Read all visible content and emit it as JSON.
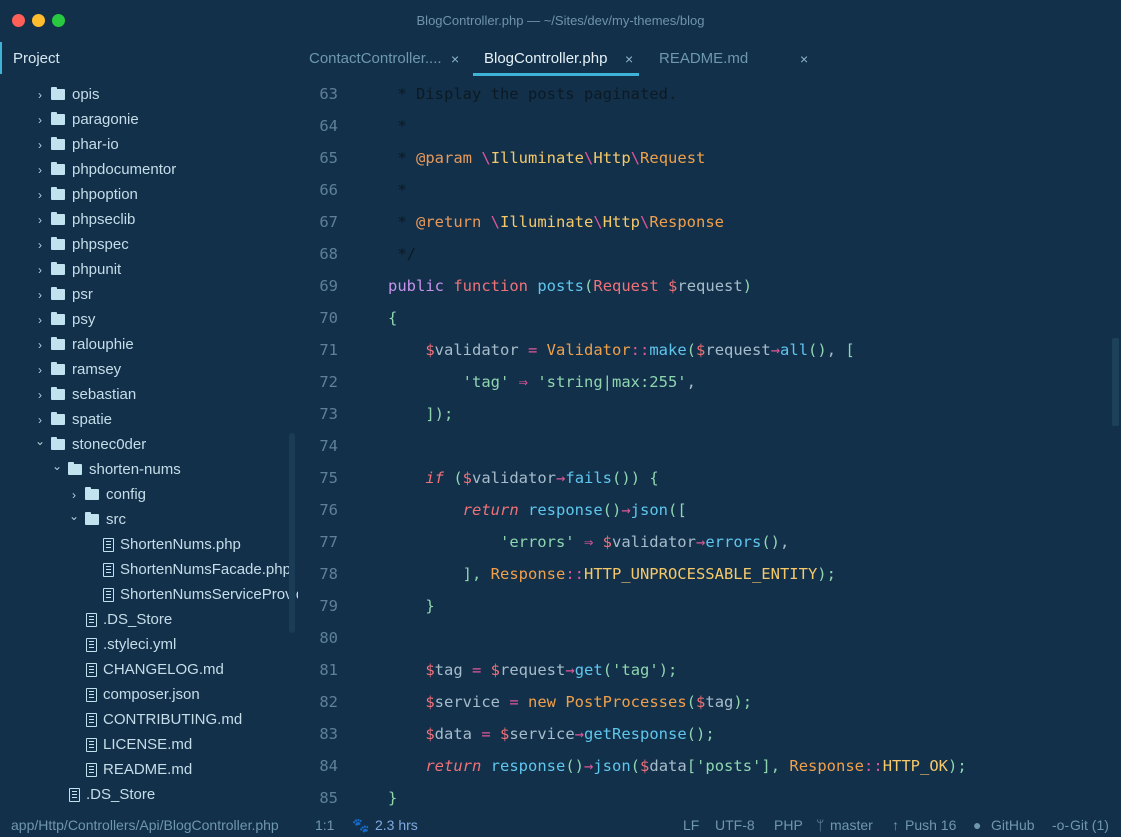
{
  "window": {
    "title": "BlogController.php — ~/Sites/dev/my-themes/blog",
    "traffic": [
      "#fe5f57",
      "#febc2e",
      "#28c840"
    ]
  },
  "sidebar": {
    "title": "Project",
    "items": [
      {
        "label": "opis",
        "type": "folder",
        "level": 1,
        "open": false
      },
      {
        "label": "paragonie",
        "type": "folder",
        "level": 1,
        "open": false
      },
      {
        "label": "phar-io",
        "type": "folder",
        "level": 1,
        "open": false
      },
      {
        "label": "phpdocumentor",
        "type": "folder",
        "level": 1,
        "open": false
      },
      {
        "label": "phpoption",
        "type": "folder",
        "level": 1,
        "open": false
      },
      {
        "label": "phpseclib",
        "type": "folder",
        "level": 1,
        "open": false
      },
      {
        "label": "phpspec",
        "type": "folder",
        "level": 1,
        "open": false
      },
      {
        "label": "phpunit",
        "type": "folder",
        "level": 1,
        "open": false
      },
      {
        "label": "psr",
        "type": "folder",
        "level": 1,
        "open": false
      },
      {
        "label": "psy",
        "type": "folder",
        "level": 1,
        "open": false
      },
      {
        "label": "ralouphie",
        "type": "folder",
        "level": 1,
        "open": false
      },
      {
        "label": "ramsey",
        "type": "folder",
        "level": 1,
        "open": false
      },
      {
        "label": "sebastian",
        "type": "folder",
        "level": 1,
        "open": false
      },
      {
        "label": "spatie",
        "type": "folder",
        "level": 1,
        "open": false
      },
      {
        "label": "stonec0der",
        "type": "folder",
        "level": 1,
        "open": true
      },
      {
        "label": "shorten-nums",
        "type": "folder",
        "level": 2,
        "open": true
      },
      {
        "label": "config",
        "type": "folder",
        "level": 3,
        "open": false
      },
      {
        "label": "src",
        "type": "folder",
        "level": 3,
        "open": true
      },
      {
        "label": "ShortenNums.php",
        "type": "file",
        "level": 4
      },
      {
        "label": "ShortenNumsFacade.php",
        "type": "file",
        "level": 4
      },
      {
        "label": "ShortenNumsServiceProvider.php",
        "type": "file",
        "level": 4
      },
      {
        "label": ".DS_Store",
        "type": "file",
        "level": 3
      },
      {
        "label": ".styleci.yml",
        "type": "file",
        "level": 3
      },
      {
        "label": "CHANGELOG.md",
        "type": "file",
        "level": 3
      },
      {
        "label": "composer.json",
        "type": "file",
        "level": 3
      },
      {
        "label": "CONTRIBUTING.md",
        "type": "file",
        "level": 3
      },
      {
        "label": "LICENSE.md",
        "type": "file",
        "level": 3
      },
      {
        "label": "README.md",
        "type": "file",
        "level": 3
      },
      {
        "label": ".DS_Store",
        "type": "file",
        "level": 2
      }
    ]
  },
  "tabs": [
    {
      "label": "ContactController....",
      "active": false
    },
    {
      "label": "BlogController.php",
      "active": true
    },
    {
      "label": "README.md",
      "active": false
    }
  ],
  "tab_close": "×",
  "code": [
    {
      "n": "63",
      "t": [
        [
          "    * Display the posts paginated.",
          "comment"
        ]
      ]
    },
    {
      "n": "64",
      "t": [
        [
          "    *",
          "comment"
        ]
      ]
    },
    {
      "n": "65",
      "t": [
        [
          "    * ",
          "comment"
        ],
        [
          "@param",
          "doctag"
        ],
        [
          " ",
          "plain"
        ],
        [
          "\\",
          "nssep"
        ],
        [
          "Illuminate",
          "ns"
        ],
        [
          "\\",
          "nssep"
        ],
        [
          "Http",
          "ns"
        ],
        [
          "\\",
          "nssep"
        ],
        [
          "Request",
          "class"
        ]
      ]
    },
    {
      "n": "66",
      "t": [
        [
          "    *",
          "comment"
        ]
      ]
    },
    {
      "n": "67",
      "t": [
        [
          "    * ",
          "comment"
        ],
        [
          "@return",
          "doctag"
        ],
        [
          " ",
          "plain"
        ],
        [
          "\\",
          "nssep"
        ],
        [
          "Illuminate",
          "ns"
        ],
        [
          "\\",
          "nssep"
        ],
        [
          "Http",
          "ns"
        ],
        [
          "\\",
          "nssep"
        ],
        [
          "Response",
          "class"
        ]
      ]
    },
    {
      "n": "68",
      "t": [
        [
          "    */",
          "comment"
        ]
      ]
    },
    {
      "n": "69",
      "t": [
        [
          "   public",
          "kw"
        ],
        [
          " ",
          "plain"
        ],
        [
          "function",
          "fn"
        ],
        [
          " ",
          "plain"
        ],
        [
          "posts",
          "name"
        ],
        [
          "(",
          "punc"
        ],
        [
          "Request",
          "fn"
        ],
        [
          " ",
          "plain"
        ],
        [
          "$",
          "dollar"
        ],
        [
          "request",
          "var"
        ],
        [
          ")",
          "punc"
        ]
      ]
    },
    {
      "n": "70",
      "t": [
        [
          "   {",
          "punc"
        ]
      ]
    },
    {
      "n": "71",
      "t": [
        [
          "       ",
          "plain"
        ],
        [
          "$",
          "dollar"
        ],
        [
          "validator",
          "var"
        ],
        [
          " = ",
          "op"
        ],
        [
          "Validator",
          "class"
        ],
        [
          "::",
          "op"
        ],
        [
          "make",
          "name"
        ],
        [
          "(",
          "punc"
        ],
        [
          "$",
          "dollar"
        ],
        [
          "request",
          "var"
        ],
        [
          "→",
          "op"
        ],
        [
          "all",
          "name"
        ],
        [
          "()",
          "punc"
        ],
        [
          ", ",
          "plain"
        ],
        [
          "[",
          "punc"
        ]
      ]
    },
    {
      "n": "72",
      "t": [
        [
          "           ",
          "plain"
        ],
        [
          "'tag'",
          "str"
        ],
        [
          " ⇒ ",
          "op"
        ],
        [
          "'string|max:255'",
          "str"
        ],
        [
          ",",
          "plain"
        ]
      ]
    },
    {
      "n": "73",
      "t": [
        [
          "       ",
          "plain"
        ],
        [
          "]);",
          "punc"
        ]
      ]
    },
    {
      "n": "74",
      "t": []
    },
    {
      "n": "75",
      "t": [
        [
          "       ",
          "plain"
        ],
        [
          "if",
          "kwi"
        ],
        [
          " (",
          "punc"
        ],
        [
          "$",
          "dollar"
        ],
        [
          "validator",
          "var"
        ],
        [
          "→",
          "op"
        ],
        [
          "fails",
          "name"
        ],
        [
          "()) {",
          "punc"
        ]
      ]
    },
    {
      "n": "76",
      "t": [
        [
          "           ",
          "plain"
        ],
        [
          "return",
          "kwi"
        ],
        [
          " ",
          "plain"
        ],
        [
          "response",
          "name"
        ],
        [
          "()",
          "punc"
        ],
        [
          "→",
          "op"
        ],
        [
          "json",
          "name"
        ],
        [
          "([",
          "punc"
        ]
      ]
    },
    {
      "n": "77",
      "t": [
        [
          "               ",
          "plain"
        ],
        [
          "'errors'",
          "str"
        ],
        [
          " ⇒ ",
          "op"
        ],
        [
          "$",
          "dollar"
        ],
        [
          "validator",
          "var"
        ],
        [
          "→",
          "op"
        ],
        [
          "errors",
          "name"
        ],
        [
          "()",
          "punc"
        ],
        [
          ",",
          "plain"
        ]
      ]
    },
    {
      "n": "78",
      "t": [
        [
          "           ",
          "plain"
        ],
        [
          "], ",
          "punc"
        ],
        [
          "Response",
          "class"
        ],
        [
          "::",
          "op"
        ],
        [
          "HTTP_UNPROCESSABLE_ENTITY",
          "const"
        ],
        [
          ");",
          "punc"
        ]
      ]
    },
    {
      "n": "79",
      "t": [
        [
          "       ",
          "plain"
        ],
        [
          "}",
          "punc"
        ]
      ]
    },
    {
      "n": "80",
      "t": []
    },
    {
      "n": "81",
      "t": [
        [
          "       ",
          "plain"
        ],
        [
          "$",
          "dollar"
        ],
        [
          "tag",
          "var"
        ],
        [
          " = ",
          "op"
        ],
        [
          "$",
          "dollar"
        ],
        [
          "request",
          "var"
        ],
        [
          "→",
          "op"
        ],
        [
          "get",
          "name"
        ],
        [
          "(",
          "punc"
        ],
        [
          "'tag'",
          "str"
        ],
        [
          ");",
          "punc"
        ]
      ]
    },
    {
      "n": "82",
      "t": [
        [
          "       ",
          "plain"
        ],
        [
          "$",
          "dollar"
        ],
        [
          "service",
          "var"
        ],
        [
          " = ",
          "op"
        ],
        [
          "new",
          "class"
        ],
        [
          " ",
          "plain"
        ],
        [
          "PostProcesses",
          "class"
        ],
        [
          "(",
          "punc"
        ],
        [
          "$",
          "dollar"
        ],
        [
          "tag",
          "var"
        ],
        [
          ");",
          "punc"
        ]
      ]
    },
    {
      "n": "83",
      "t": [
        [
          "       ",
          "plain"
        ],
        [
          "$",
          "dollar"
        ],
        [
          "data",
          "var"
        ],
        [
          " = ",
          "op"
        ],
        [
          "$",
          "dollar"
        ],
        [
          "service",
          "var"
        ],
        [
          "→",
          "op"
        ],
        [
          "getResponse",
          "name"
        ],
        [
          "();",
          "punc"
        ]
      ]
    },
    {
      "n": "84",
      "t": [
        [
          "       ",
          "plain"
        ],
        [
          "return",
          "kwi"
        ],
        [
          " ",
          "plain"
        ],
        [
          "response",
          "name"
        ],
        [
          "()",
          "punc"
        ],
        [
          "→",
          "op"
        ],
        [
          "json",
          "name"
        ],
        [
          "(",
          "punc"
        ],
        [
          "$",
          "dollar"
        ],
        [
          "data",
          "var"
        ],
        [
          "[",
          "punc"
        ],
        [
          "'posts'",
          "str"
        ],
        [
          "], ",
          "punc"
        ],
        [
          "Response",
          "class"
        ],
        [
          "::",
          "op"
        ],
        [
          "HTTP_OK",
          "const"
        ],
        [
          ");",
          "punc"
        ]
      ]
    },
    {
      "n": "85",
      "t": [
        [
          "   }",
          "punc"
        ]
      ]
    }
  ],
  "status": {
    "path": "app/Http/Controllers/Api/BlogController.php",
    "cursor": "1:1",
    "time": "2.3 hrs",
    "eol": "LF",
    "encoding": "UTF-8",
    "grammar": "PHP",
    "branch": "master",
    "push": "Push 16",
    "github": "GitHub",
    "git": "Git (1)"
  }
}
